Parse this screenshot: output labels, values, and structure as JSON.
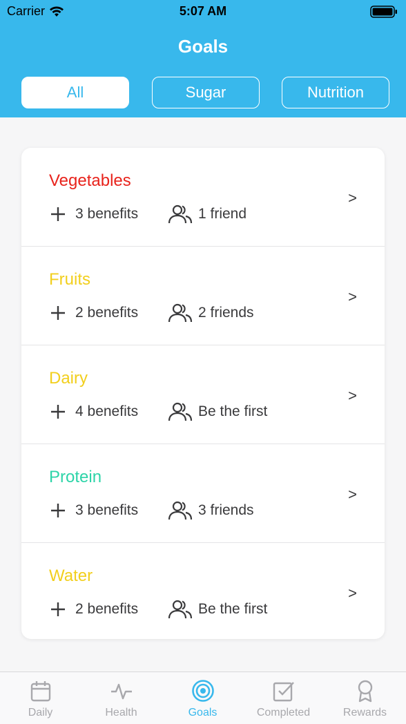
{
  "status_bar": {
    "carrier": "Carrier",
    "time": "5:07 AM"
  },
  "header": {
    "title": "Goals"
  },
  "filter_tabs": [
    {
      "label": "All",
      "active": true
    },
    {
      "label": "Sugar",
      "active": false
    },
    {
      "label": "Nutrition",
      "active": false
    }
  ],
  "goals": [
    {
      "name": "Vegetables",
      "color": "#e8231c",
      "benefits": "3 benefits",
      "friends": "1 friend"
    },
    {
      "name": "Fruits",
      "color": "#f2cf1d",
      "benefits": "2 benefits",
      "friends": "2 friends"
    },
    {
      "name": "Dairy",
      "color": "#f2cf1d",
      "benefits": "4 benefits",
      "friends": "Be the first"
    },
    {
      "name": "Protein",
      "color": "#2dd4a8",
      "benefits": "3 benefits",
      "friends": "3 friends"
    },
    {
      "name": "Water",
      "color": "#f2cf1d",
      "benefits": "2 benefits",
      "friends": "Be the first"
    }
  ],
  "chevron": ">",
  "tabbar": [
    {
      "label": "Daily",
      "icon": "calendar-icon"
    },
    {
      "label": "Health",
      "icon": "pulse-icon"
    },
    {
      "label": "Goals",
      "icon": "target-icon",
      "active": true
    },
    {
      "label": "Completed",
      "icon": "checkbox-icon"
    },
    {
      "label": "Rewards",
      "icon": "award-icon"
    }
  ],
  "colors": {
    "accent": "#38b8ec",
    "inactive": "#a8a8ac"
  }
}
